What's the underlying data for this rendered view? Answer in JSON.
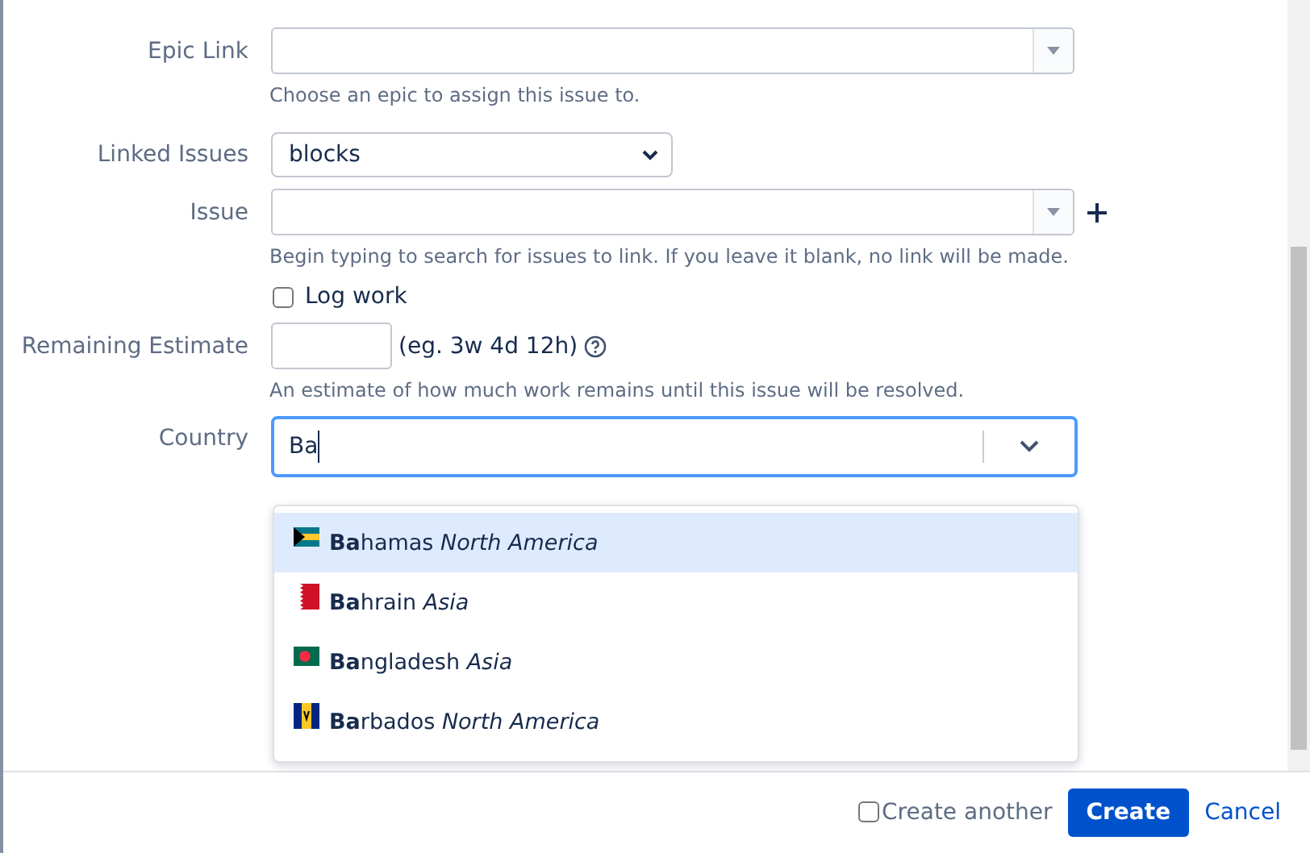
{
  "epic_link": {
    "label": "Epic Link",
    "help": "Choose an epic to assign this issue to."
  },
  "linked_issues": {
    "label": "Linked Issues",
    "value": "blocks"
  },
  "issue": {
    "label": "Issue",
    "help": "Begin typing to search for issues to link. If you leave it blank, no link will be made."
  },
  "log_work": {
    "label": "Log work",
    "checked": false
  },
  "remaining_estimate": {
    "label": "Remaining Estimate",
    "hint": "(eg. 3w 4d 12h)",
    "help": "An estimate of how much work remains until this issue will be resolved."
  },
  "country": {
    "label": "Country",
    "value": "Ba",
    "options": [
      {
        "text": "**Ba**hamas *North America*",
        "kind": "chevron-stripes",
        "selected": true
      },
      {
        "text": "**Ba**hrain *Asia*",
        "kind": "serrated",
        "selected": false
      },
      {
        "text": "**Ba**ngladesh *Asia*",
        "kind": "disc",
        "selected": false
      },
      {
        "text": "**Ba**rbados *North America*",
        "kind": "triband",
        "selected": false
      }
    ]
  },
  "footer": {
    "create_another": {
      "label": "Create another",
      "checked": false
    },
    "create": "Create",
    "cancel": "Cancel"
  }
}
